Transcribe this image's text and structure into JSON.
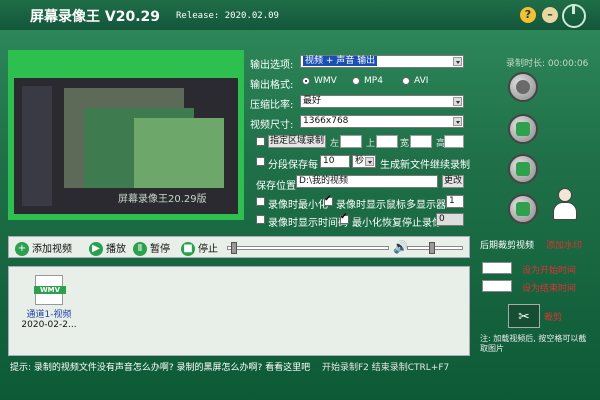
{
  "app": {
    "title": "屏幕录像王 V20.29",
    "release": "Release: 2020.02.09"
  },
  "titlebar": {
    "help_icon": "question-icon",
    "minimize_icon": "minimize-icon",
    "power_icon": "power-icon",
    "help_label": "?",
    "minimize_label": "–"
  },
  "preview": {
    "watermark": "屏幕录像王20.29版"
  },
  "settings": {
    "output_option_label": "输出选项:",
    "output_option_value": "视频 + 声音 输出",
    "output_format_label": "输出格式:",
    "formats": [
      "WMV",
      "MP4",
      "AVI"
    ],
    "compression_label": "压缩比率:",
    "compression_value": "最好",
    "video_size_label": "视频尺寸:",
    "video_size_value": "1366x768",
    "region_button": "指定区域录制",
    "left_label": "左",
    "top_label": "上",
    "width_label": "宽",
    "height_label": "高",
    "segment_label": "分段保存",
    "every_label": "每",
    "segment_value": "10",
    "segment_unit": "秒",
    "segment_suffix": "生成新文件继续录制",
    "save_location_label": "保存位置",
    "save_location_value": "D:\\我的视频",
    "change_button": "更改",
    "minimize_on_record": "录像时最小化",
    "show_mouse": "录像时显示鼠标",
    "multi_monitor": "多显示器",
    "multi_monitor_value": "1",
    "show_timecode": "录像时显示时间码",
    "minimize_restore_stop": "最小化恢复停止录像",
    "stop_value": "0"
  },
  "right": {
    "record_time": "录制时长: 00:00:06"
  },
  "toolbar": {
    "add_video": "添加视频",
    "play": "播放",
    "pause": "暂停",
    "stop": "停止",
    "speaker_icon": "speaker-icon"
  },
  "files": [
    {
      "badge": "WMV",
      "name": "通道1-视频",
      "date": "2020-02-2..."
    }
  ],
  "post": {
    "edit_title": "后期裁剪视频",
    "add_watermark": "添加水印",
    "set_start": "设为开始时间",
    "set_end": "设为结束时间",
    "crop_label": "裁剪",
    "hint": "注: 加载视频后, 按空格可以截取图片"
  },
  "status": {
    "tip": "提示: 录制的视频文件没有声音怎么办啊? 录制的黑屏怎么办啊? 看看这里吧",
    "shortcuts": "开始录制F2   结束录制CTRL+F7"
  }
}
